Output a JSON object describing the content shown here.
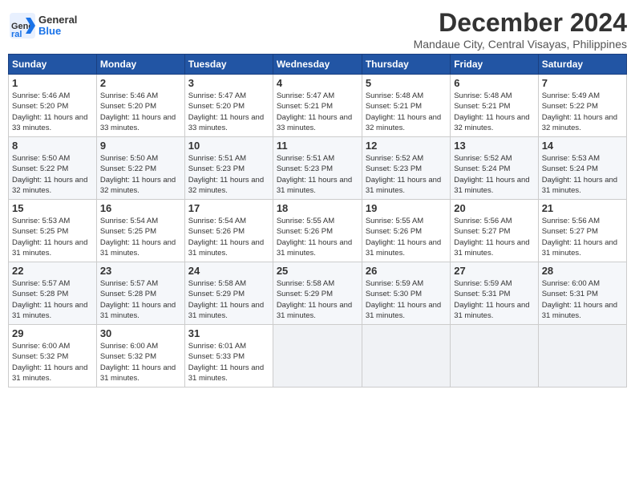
{
  "header": {
    "logo_general": "General",
    "logo_blue": "Blue",
    "month_title": "December 2024",
    "location": "Mandaue City, Central Visayas, Philippines"
  },
  "columns": [
    "Sunday",
    "Monday",
    "Tuesday",
    "Wednesday",
    "Thursday",
    "Friday",
    "Saturday"
  ],
  "weeks": [
    [
      {
        "day": "1",
        "sunrise": "5:46 AM",
        "sunset": "5:20 PM",
        "daylight": "11 hours and 33 minutes"
      },
      {
        "day": "2",
        "sunrise": "5:46 AM",
        "sunset": "5:20 PM",
        "daylight": "11 hours and 33 minutes"
      },
      {
        "day": "3",
        "sunrise": "5:47 AM",
        "sunset": "5:20 PM",
        "daylight": "11 hours and 33 minutes"
      },
      {
        "day": "4",
        "sunrise": "5:47 AM",
        "sunset": "5:21 PM",
        "daylight": "11 hours and 33 minutes"
      },
      {
        "day": "5",
        "sunrise": "5:48 AM",
        "sunset": "5:21 PM",
        "daylight": "11 hours and 32 minutes"
      },
      {
        "day": "6",
        "sunrise": "5:48 AM",
        "sunset": "5:21 PM",
        "daylight": "11 hours and 32 minutes"
      },
      {
        "day": "7",
        "sunrise": "5:49 AM",
        "sunset": "5:22 PM",
        "daylight": "11 hours and 32 minutes"
      }
    ],
    [
      {
        "day": "8",
        "sunrise": "5:50 AM",
        "sunset": "5:22 PM",
        "daylight": "11 hours and 32 minutes"
      },
      {
        "day": "9",
        "sunrise": "5:50 AM",
        "sunset": "5:22 PM",
        "daylight": "11 hours and 32 minutes"
      },
      {
        "day": "10",
        "sunrise": "5:51 AM",
        "sunset": "5:23 PM",
        "daylight": "11 hours and 32 minutes"
      },
      {
        "day": "11",
        "sunrise": "5:51 AM",
        "sunset": "5:23 PM",
        "daylight": "11 hours and 31 minutes"
      },
      {
        "day": "12",
        "sunrise": "5:52 AM",
        "sunset": "5:23 PM",
        "daylight": "11 hours and 31 minutes"
      },
      {
        "day": "13",
        "sunrise": "5:52 AM",
        "sunset": "5:24 PM",
        "daylight": "11 hours and 31 minutes"
      },
      {
        "day": "14",
        "sunrise": "5:53 AM",
        "sunset": "5:24 PM",
        "daylight": "11 hours and 31 minutes"
      }
    ],
    [
      {
        "day": "15",
        "sunrise": "5:53 AM",
        "sunset": "5:25 PM",
        "daylight": "11 hours and 31 minutes"
      },
      {
        "day": "16",
        "sunrise": "5:54 AM",
        "sunset": "5:25 PM",
        "daylight": "11 hours and 31 minutes"
      },
      {
        "day": "17",
        "sunrise": "5:54 AM",
        "sunset": "5:26 PM",
        "daylight": "11 hours and 31 minutes"
      },
      {
        "day": "18",
        "sunrise": "5:55 AM",
        "sunset": "5:26 PM",
        "daylight": "11 hours and 31 minutes"
      },
      {
        "day": "19",
        "sunrise": "5:55 AM",
        "sunset": "5:26 PM",
        "daylight": "11 hours and 31 minutes"
      },
      {
        "day": "20",
        "sunrise": "5:56 AM",
        "sunset": "5:27 PM",
        "daylight": "11 hours and 31 minutes"
      },
      {
        "day": "21",
        "sunrise": "5:56 AM",
        "sunset": "5:27 PM",
        "daylight": "11 hours and 31 minutes"
      }
    ],
    [
      {
        "day": "22",
        "sunrise": "5:57 AM",
        "sunset": "5:28 PM",
        "daylight": "11 hours and 31 minutes"
      },
      {
        "day": "23",
        "sunrise": "5:57 AM",
        "sunset": "5:28 PM",
        "daylight": "11 hours and 31 minutes"
      },
      {
        "day": "24",
        "sunrise": "5:58 AM",
        "sunset": "5:29 PM",
        "daylight": "11 hours and 31 minutes"
      },
      {
        "day": "25",
        "sunrise": "5:58 AM",
        "sunset": "5:29 PM",
        "daylight": "11 hours and 31 minutes"
      },
      {
        "day": "26",
        "sunrise": "5:59 AM",
        "sunset": "5:30 PM",
        "daylight": "11 hours and 31 minutes"
      },
      {
        "day": "27",
        "sunrise": "5:59 AM",
        "sunset": "5:31 PM",
        "daylight": "11 hours and 31 minutes"
      },
      {
        "day": "28",
        "sunrise": "6:00 AM",
        "sunset": "5:31 PM",
        "daylight": "11 hours and 31 minutes"
      }
    ],
    [
      {
        "day": "29",
        "sunrise": "6:00 AM",
        "sunset": "5:32 PM",
        "daylight": "11 hours and 31 minutes"
      },
      {
        "day": "30",
        "sunrise": "6:00 AM",
        "sunset": "5:32 PM",
        "daylight": "11 hours and 31 minutes"
      },
      {
        "day": "31",
        "sunrise": "6:01 AM",
        "sunset": "5:33 PM",
        "daylight": "11 hours and 31 minutes"
      },
      null,
      null,
      null,
      null
    ]
  ]
}
